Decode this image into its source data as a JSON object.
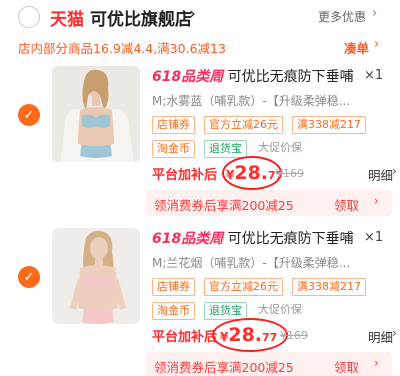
{
  "store": {
    "platform_badge": "天猫",
    "name": "可优比旗舰店",
    "chevron": "›",
    "more_deals": "更多优惠",
    "more_chevron": "›"
  },
  "promo": {
    "text": "店内部分商品16.9减4.4,满30.6减13",
    "coupon_link": "凑单",
    "coupon_chevron": "›"
  },
  "items": [
    {
      "checked": true,
      "check_glyph": "✓",
      "title_hot": "618品类周",
      "title_rest": " 可优比无痕防下垂哺",
      "quantity": "×1",
      "sku": "M;水雾蓝（哺乳款）-【升级柔弹稳...",
      "tags": [
        "店铺券",
        "官方立减26元",
        "满338减217",
        "淘金币",
        "退货宝",
        "大促价保"
      ],
      "platform_label": "平台加补后",
      "price_yen": "¥",
      "price_int": "28.",
      "price_dec": "77",
      "original_price": "¥169",
      "detail_link": "明细",
      "detail_chevron": "›",
      "voucher_text": "领消费券后享满200减25",
      "claim_link": "领取",
      "claim_chevron": "›"
    },
    {
      "checked": true,
      "check_glyph": "✓",
      "title_hot": "618品类周",
      "title_rest": " 可优比无痕防下垂哺",
      "quantity": "×1",
      "sku": "M;兰花烟（哺乳款）-【升级柔弹稳...",
      "tags": [
        "店铺券",
        "官方立减26元",
        "满338减217",
        "淘金币",
        "退货宝",
        "大促价保"
      ],
      "platform_label": "平台加补后",
      "price_yen": "¥",
      "price_int": "28.",
      "price_dec": "77",
      "original_price": "¥169",
      "detail_link": "明细",
      "detail_chevron": "›",
      "voucher_text": "领消费券后享满200减25",
      "claim_link": "领取",
      "claim_chevron": "›"
    }
  ],
  "colors": {
    "accent_orange": "#ff6a1a",
    "price_red": "#ff2d2d",
    "tmall_red": "#ff2d2d",
    "annotation_ring": "#ff1c1c",
    "voucher_bg": "#fff0f0",
    "tag_green": "#1aa35d"
  }
}
